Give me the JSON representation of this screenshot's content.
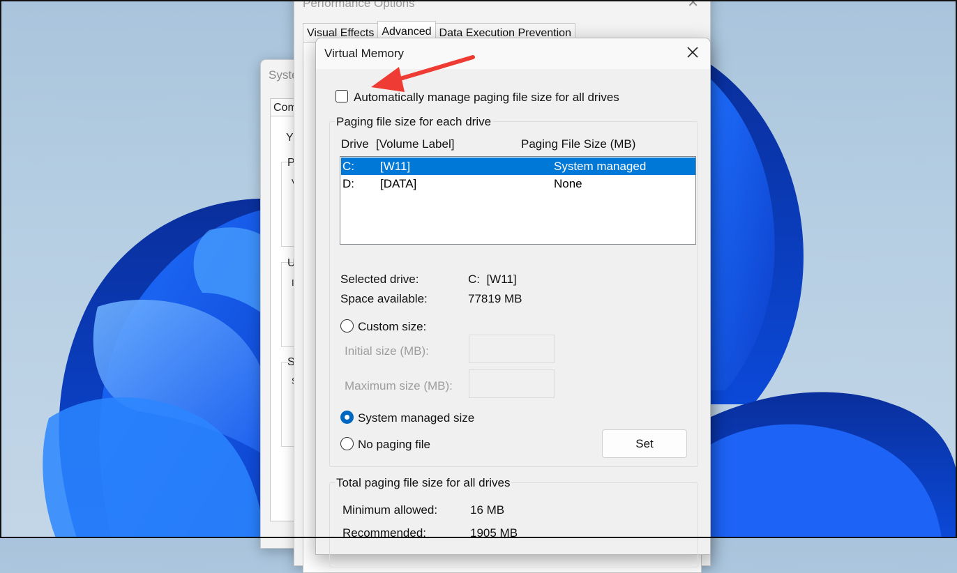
{
  "colors": {
    "accent": "#0078d7",
    "annotation_arrow": "#ee3b33"
  },
  "system_properties": {
    "title": "Syste",
    "tab": "Com",
    "letters": [
      "Y",
      "P",
      "V",
      "U",
      "I",
      "S",
      "S"
    ]
  },
  "performance_options": {
    "title": "Performance Options",
    "close_icon": "close-icon",
    "tabs": [
      "Visual Effects",
      "Advanced",
      "Data Execution Prevention"
    ],
    "active_tab": "Advanced"
  },
  "virtual_memory": {
    "title": "Virtual Memory",
    "close_icon": "close-icon",
    "auto_manage": {
      "label": "Automatically manage paging file size for all drives",
      "checked": false
    },
    "paging_group": {
      "legend": "Paging file size for each drive",
      "columns": {
        "drive": "Drive",
        "volume": "[Volume Label]",
        "size": "Paging File Size (MB)"
      },
      "rows": [
        {
          "drive": "C:",
          "volume": "[W11]",
          "size": "System managed",
          "selected": true
        },
        {
          "drive": "D:",
          "volume": "[DATA]",
          "size": "None",
          "selected": false
        }
      ],
      "selected_drive_label": "Selected drive:",
      "selected_drive_value": "C:  [W11]",
      "space_label": "Space available:",
      "space_value": "77819 MB",
      "custom_size_label": "Custom size:",
      "initial_size_label": "Initial size (MB):",
      "initial_size_value": "",
      "max_size_label": "Maximum size (MB):",
      "max_size_value": "",
      "system_managed_label": "System managed size",
      "no_paging_label": "No paging file",
      "selected_option": "System managed size",
      "set_button": "Set"
    },
    "total_group": {
      "legend": "Total paging file size for all drives",
      "min_label": "Minimum allowed:",
      "min_value": "16 MB",
      "rec_label": "Recommended:",
      "rec_value": "1905 MB"
    }
  }
}
